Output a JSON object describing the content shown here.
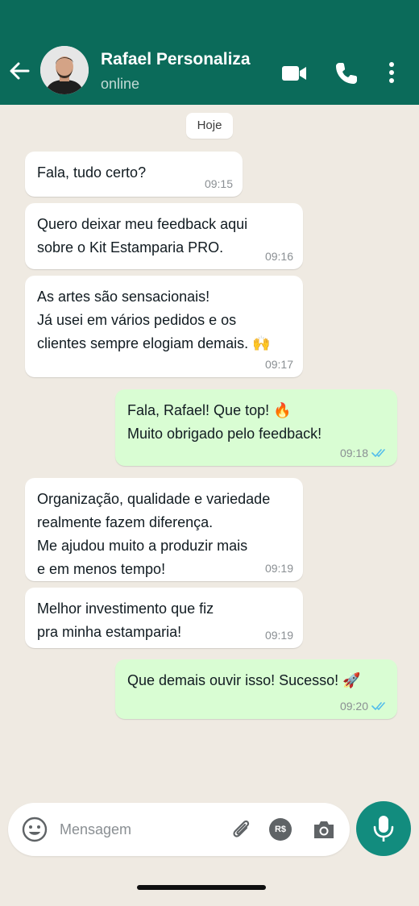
{
  "header": {
    "contact_name": "Rafael Personaliza",
    "status": "online",
    "background_color": "#0b6b5a",
    "icons": [
      "back-arrow-icon",
      "video-call-icon",
      "phone-icon",
      "more-vert-icon"
    ]
  },
  "date_separator": "Hoje",
  "messages": [
    {
      "direction": "incoming",
      "text": "Fala, tudo certo?",
      "time": "09:15"
    },
    {
      "direction": "incoming",
      "text": "Quero deixar meu feedback aqui\nsobre o Kit Estamparia PRO.",
      "time": "09:16"
    },
    {
      "direction": "incoming",
      "text": "As artes são sensacionais!\nJá usei em vários pedidos e os\nclientes sempre elogiam demais. 🙌",
      "time": "09:17"
    },
    {
      "direction": "outgoing",
      "text": "Fala, Rafael! Que top! 🔥\nMuito obrigado pelo feedback!",
      "time": "09:18",
      "read": true
    },
    {
      "direction": "incoming",
      "text": "Organização, qualidade e variedade\nrealmente fazem diferença.\nMe ajudou muito a produzir mais\ne em menos tempo!",
      "time": "09:19"
    },
    {
      "direction": "incoming",
      "text": "Melhor investimento que fiz\npra minha estamparia!",
      "time": "09:19"
    },
    {
      "direction": "outgoing",
      "text": "Que demais ouvir isso! Sucesso! 🚀",
      "time": "09:20",
      "read": true
    }
  ],
  "composer": {
    "placeholder": "Mensagem",
    "pix_label": "R$",
    "icons": [
      "emoji-icon",
      "paperclip-icon",
      "pix-icon",
      "camera-icon",
      "mic-icon"
    ]
  },
  "colors": {
    "chat_background": "#efeae2",
    "incoming_bubble": "#ffffff",
    "outgoing_bubble": "#d9fdd3",
    "read_ticks": "#53bdeb",
    "mic_button": "#128c7e"
  }
}
